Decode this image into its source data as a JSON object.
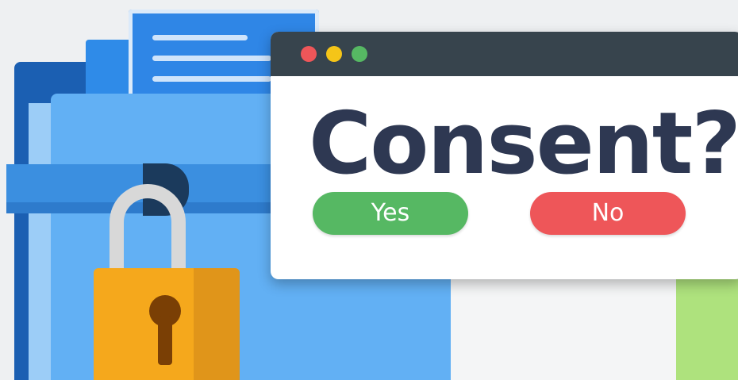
{
  "dialog": {
    "heading": "Consent?",
    "yes_label": "Yes",
    "no_label": "No",
    "traffic_lights": [
      "#ee5659",
      "#f5c518",
      "#56b863"
    ]
  },
  "colors": {
    "heading_text": "#2e3852",
    "titlebar": "#37444d",
    "yes_button": "#56b863",
    "no_button": "#ee5659",
    "folder": "#62b0f4",
    "lock": "#f5a81c"
  },
  "icons": [
    "folder-icon",
    "document-icon",
    "padlock-icon",
    "keyhole-icon"
  ]
}
